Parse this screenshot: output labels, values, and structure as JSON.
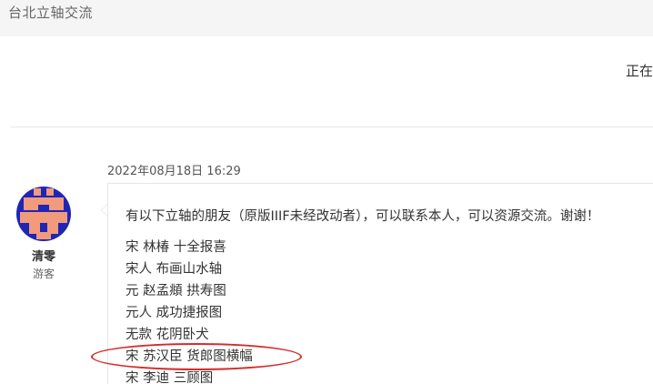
{
  "topbar": {
    "title": "台北立轴交流"
  },
  "status": {
    "text": "正在"
  },
  "post": {
    "date": "2022年08月18日 16:29",
    "author": {
      "name": "清零",
      "role": "游客",
      "avatar_colors": {
        "background": "#1f26b6",
        "pattern": "#f19a7c"
      }
    },
    "intro": "有以下立轴的朋友（原版IIIF未经改动者），可以联系本人，可以资源交流。谢谢！",
    "items": [
      "宋 林椿 十全报喜",
      "宋人 布画山水轴",
      "元 赵孟頫 拱寿图",
      "元人 成功捷报图",
      "无款 花阴卧犬",
      "宋 苏汉臣 货郎图横幅",
      "宋 李迪 三顾图"
    ],
    "highlighted_item_index": 5
  },
  "colors": {
    "highlight": "#d42c2c",
    "topbar_bg": "#f5f5f5",
    "bubble_border": "#e6e6e6"
  }
}
